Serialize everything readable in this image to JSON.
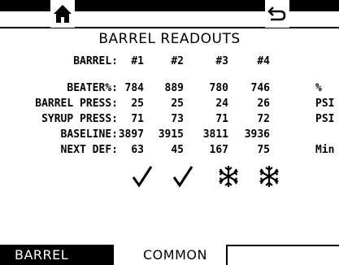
{
  "screen": {
    "title": "BARREL READOUTS",
    "icons": {
      "home": "home-icon",
      "back": "back-arrow-icon"
    }
  },
  "barrels": {
    "label": "BARREL:",
    "ids": [
      "#1",
      "#2",
      "#3",
      "#4"
    ]
  },
  "rows": [
    {
      "label": "BEATER%:",
      "values": [
        "784",
        "889",
        "780",
        "746"
      ],
      "unit": "%"
    },
    {
      "label": "BARREL PRESS:",
      "values": [
        "25",
        "25",
        "24",
        "26"
      ],
      "unit": "PSI"
    },
    {
      "label": "SYRUP PRESS:",
      "values": [
        "71",
        "73",
        "71",
        "72"
      ],
      "unit": "PSI"
    },
    {
      "label": "BASELINE:",
      "values": [
        "3897",
        "3915",
        "3811",
        "3936"
      ],
      "unit": ""
    },
    {
      "label": "NEXT DEF:",
      "values": [
        "63",
        "45",
        "167",
        "75"
      ],
      "unit": "Min"
    }
  ],
  "status_icons": [
    "check-icon",
    "check-icon",
    "snowflake-icon",
    "snowflake-icon"
  ],
  "tabs": [
    {
      "label": "BARREL",
      "active": true
    },
    {
      "label": "COMMON",
      "active": false
    }
  ],
  "colors": {
    "foreground": "#000000",
    "background": "#ffffff"
  }
}
